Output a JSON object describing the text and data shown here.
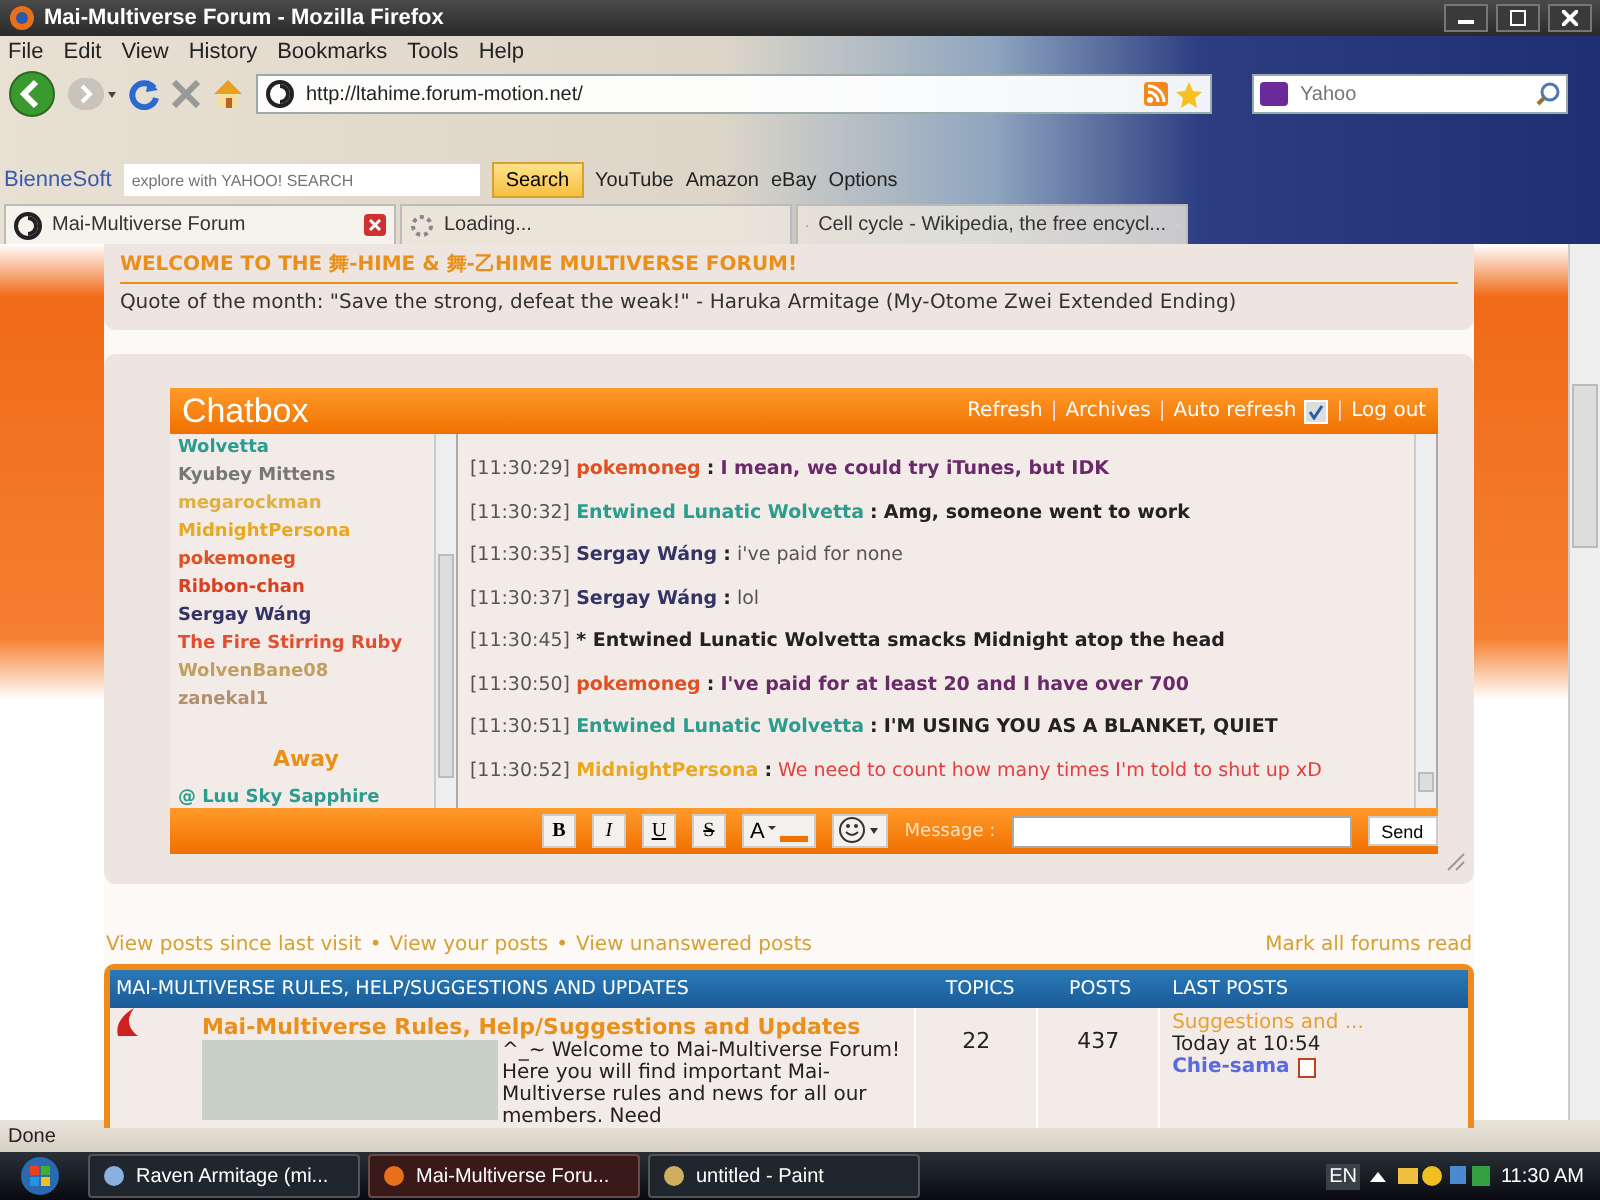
{
  "window": {
    "title": "Mai-Multiverse Forum - Mozilla Firefox"
  },
  "menu": [
    "File",
    "Edit",
    "View",
    "History",
    "Bookmarks",
    "Tools",
    "Help"
  ],
  "address": {
    "value": "http://ltahime.forum-motion.net/"
  },
  "search": {
    "placeholder": "Yahoo"
  },
  "bookmarks_bar": {
    "brand": "BienneSoft",
    "search_placeholder": "explore with YAHOO! SEARCH",
    "search_button": "Search",
    "links": [
      "YouTube",
      "Amazon",
      "eBay",
      "Options"
    ]
  },
  "tabs": [
    {
      "label": "Mai-Multiverse Forum",
      "selected": true
    },
    {
      "label": "Loading...",
      "selected": false
    },
    {
      "label": "Cell cycle - Wikipedia, the free encycl...",
      "selected": false
    }
  ],
  "welcome": {
    "title": "WELCOME TO THE 舞-HIME & 舞-乙HIME MULTIVERSE FORUM!",
    "quote": "Quote of the month: \"Save the strong, defeat the weak!\" - Haruka Armitage (My-Otome Zwei Extended Ending)"
  },
  "chatbox": {
    "title": "Chatbox",
    "links": [
      "Refresh",
      "Archives"
    ],
    "separator": "|",
    "auto_refresh": {
      "label": "Auto refresh",
      "checked": true
    },
    "logout": "Log out",
    "users": [
      {
        "name": "Wolvetta",
        "color": "#2a9d8f"
      },
      {
        "name": "Kyubey Mittens",
        "color": "#777777"
      },
      {
        "name": "megarockman",
        "color": "#e0b040"
      },
      {
        "name": "MidnightPersona",
        "color": "#e8a820"
      },
      {
        "name": "pokemoneg",
        "color": "#e05020"
      },
      {
        "name": "Ribbon-chan",
        "color": "#d84020"
      },
      {
        "name": "Sergay Wáng",
        "color": "#333366"
      },
      {
        "name": "The Fire Stirring Ruby",
        "color": "#e05030"
      },
      {
        "name": "WolvenBane08",
        "color": "#c0a060"
      },
      {
        "name": "zanekal1",
        "color": "#b09070"
      }
    ],
    "away_heading": "Away",
    "away_users": [
      {
        "name": "@ Luu Sky Sapphire",
        "color": "#2a9d8f"
      }
    ],
    "messages": [
      {
        "kind": "message",
        "time": "[11:30:29]",
        "user": {
          "name": "pokemoneg",
          "color": "#e05020"
        },
        "sep": ":",
        "body": {
          "text": "I mean, we could try iTunes, but IDK",
          "color": "#6a2a6a",
          "bold": true
        }
      },
      {
        "kind": "message",
        "time": "[11:30:32]",
        "user": {
          "name": "Entwined Lunatic Wolvetta",
          "color": "#2a9d8f"
        },
        "sep": ":",
        "body": {
          "text": "Amg, someone went to work",
          "color": "#222222",
          "bold": true
        }
      },
      {
        "kind": "message",
        "time": "[11:30:35]",
        "user": {
          "name": "Sergay Wáng",
          "color": "#333366"
        },
        "sep": ":",
        "body": {
          "text": "i've paid for none",
          "color": "#555555",
          "bold": false
        }
      },
      {
        "kind": "message",
        "time": "[11:30:37]",
        "user": {
          "name": "Sergay Wáng",
          "color": "#333366"
        },
        "sep": ":",
        "body": {
          "text": "lol",
          "color": "#555555",
          "bold": false
        }
      },
      {
        "kind": "action",
        "time": "[11:30:45]",
        "body": {
          "text": "* Entwined Lunatic Wolvetta smacks Midnight atop the head",
          "color": "#222222",
          "bold": true
        }
      },
      {
        "kind": "message",
        "time": "[11:30:50]",
        "user": {
          "name": "pokemoneg",
          "color": "#e05020"
        },
        "sep": ":",
        "body": {
          "text": "I've paid for at least 20 and I have over 700",
          "color": "#6a2a6a",
          "bold": true
        }
      },
      {
        "kind": "message",
        "time": "[11:30:51]",
        "user": {
          "name": "Entwined Lunatic Wolvetta",
          "color": "#2a9d8f"
        },
        "sep": ":",
        "body": {
          "text": "I'M USING YOU AS A BLANKET, QUIET",
          "color": "#222222",
          "bold": true
        }
      },
      {
        "kind": "message",
        "time": "[11:30:52]",
        "user": {
          "name": "MidnightPersona",
          "color": "#e8a820"
        },
        "sep": ":",
        "body": {
          "text": "We need to count how many times I'm told to shut up xD",
          "color": "#e04040",
          "bold": false
        }
      }
    ],
    "format_buttons": [
      "B",
      "I",
      "U",
      "S"
    ],
    "font_color_button": "A",
    "message_label": "Message :",
    "send": "Send"
  },
  "forum_links": {
    "links": [
      "View posts since last visit",
      "View your posts",
      "View unanswered posts"
    ],
    "separator": "•",
    "mark_read": "Mark all forums read"
  },
  "category": {
    "title": "MAI-MULTIVERSE RULES, HELP/SUGGESTIONS AND UPDATES",
    "columns": [
      "TOPICS",
      "POSTS",
      "LAST POSTS"
    ],
    "forum": {
      "title": "Mai-Multiverse Rules, Help/Suggestions and Updates",
      "description": "^_~ Welcome to Mai-Multiverse Forum! Here you will find important Mai-Multiverse rules and news for all our members. Need",
      "topics": "22",
      "posts": "437",
      "last_post": {
        "title": "Suggestions and ...",
        "time": "Today at 10:54",
        "author": "Chie-sama"
      }
    }
  },
  "status_bar": {
    "text": "Done"
  },
  "taskbar": {
    "items": [
      {
        "label": "Raven Armitage (mi...",
        "selected": false
      },
      {
        "label": "Mai-Multiverse Foru...",
        "selected": true
      },
      {
        "label": "untitled - Paint",
        "selected": false
      }
    ],
    "language": "EN",
    "clock": "11:30 AM"
  }
}
